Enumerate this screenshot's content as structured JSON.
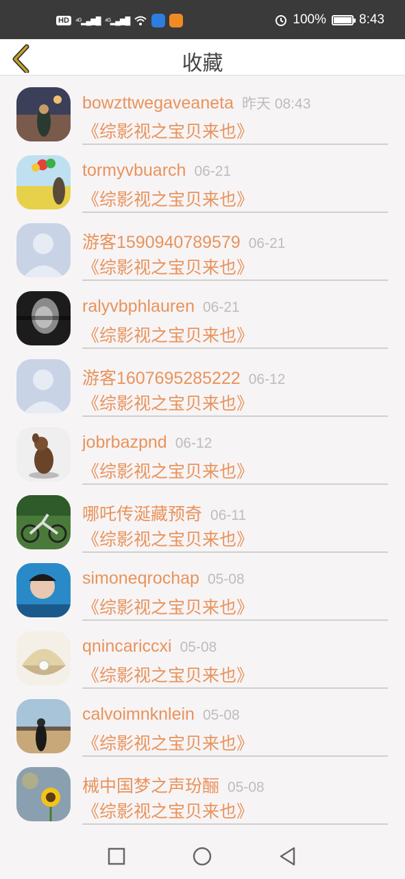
{
  "status_bar": {
    "left": {
      "hd": "HD",
      "sig1": "⁴ᴳ▂▄▆█",
      "sig2": "⁴ᴳ▂▄▆█",
      "wifi": "wifi-icon"
    },
    "battery_pct": "100%",
    "battery_level": 1.0,
    "time": "8:43"
  },
  "header": {
    "title": "收藏",
    "back_icon": "back-chevron-icon"
  },
  "items": [
    {
      "name": "bowzttwegaveaneta",
      "time": "昨天 08:43",
      "work": "《综影视之宝贝来也》",
      "avatar": "girl-night-street"
    },
    {
      "name": "tormyvbuarch",
      "time": "06-21",
      "work": "《综影视之宝贝来也》",
      "avatar": "girl-balloons-field"
    },
    {
      "name": "游客1590940789579",
      "time": "06-21",
      "work": "《综影视之宝贝来也》",
      "avatar": "default-silhouette"
    },
    {
      "name": "ralyvbphlauren",
      "time": "06-21",
      "work": "《综影视之宝贝来也》",
      "avatar": "bw-portrait"
    },
    {
      "name": "游客1607695285222",
      "time": "06-12",
      "work": "《综影视之宝贝来也》",
      "avatar": "default-silhouette"
    },
    {
      "name": "jobrbazpnd",
      "time": "06-12",
      "work": "《综影视之宝贝来也》",
      "avatar": "bronze-figurine"
    },
    {
      "name": "哪吒传涎藏预奇",
      "time": "06-11",
      "work": "《综影视之宝贝来也》",
      "avatar": "kids-bicycle"
    },
    {
      "name": "simoneqrochap",
      "time": "05-08",
      "work": "《综影视之宝贝来也》",
      "avatar": "boy-blue"
    },
    {
      "name": "qnincariccxi",
      "time": "05-08",
      "work": "《综影视之宝贝来也》",
      "avatar": "pearl-shell"
    },
    {
      "name": "calvoimnknlein",
      "time": "05-08",
      "work": "《综影视之宝贝来也》",
      "avatar": "girl-beach"
    },
    {
      "name": "械中国梦之声玢酾",
      "time": "05-08",
      "work": "《综影视之宝贝来也》",
      "avatar": "sunflower"
    }
  ],
  "nav": {
    "recent": "square-icon",
    "home": "circle-icon",
    "back": "triangle-back-icon"
  },
  "colors": {
    "accent": "#e8935a",
    "time": "#bdbdbd",
    "status_bar": "#3a3a3a",
    "back_icon": "#c9a227"
  }
}
